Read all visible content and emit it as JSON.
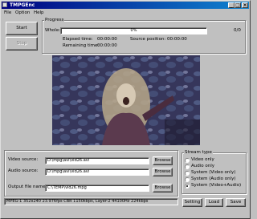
{
  "window": {
    "title": "TMPGEnc"
  },
  "titlebar": {
    "minimize": "_",
    "maximize": "□",
    "close": "×"
  },
  "menu": [
    "File",
    "Option",
    "Help"
  ],
  "buttons": {
    "start": "Start",
    "stop": "Stop",
    "browse": "Browse",
    "setting": "Setting",
    "load": "Load",
    "save": "Save"
  },
  "progress": {
    "group_label": "Progress",
    "whole_label": "Whole:",
    "percent_text": "0%",
    "fraction": 0,
    "frame_count": "0/0",
    "elapsed_label": "Elapsed time:",
    "elapsed_value": "00:00:00",
    "remaining_label": "Remaining time:",
    "remaining_value": "00:00:00",
    "source_pos_label": "Source position:",
    "source_pos_value": "00:00:00"
  },
  "fields": {
    "video_source_label": "Video source:",
    "video_source_value": "D:\\mpg\\avi\\vid26.avi",
    "audio_source_label": "Audio source:",
    "audio_source_value": "D:\\mpg\\avi\\vid26.avi",
    "output_label": "Output file name:",
    "output_value": "C:\\TEMP\\vid26.mpg"
  },
  "stream_type": {
    "label": "Stream type",
    "options": [
      "Video only",
      "Audio only",
      "System (Video only)",
      "System (Audio only)",
      "System (Video+Audio)"
    ],
    "selected": "System (Video+Audio)"
  },
  "status": {
    "text": "MPEG-1 352x240 23.976fps CBR 1150kbps, Layer-2 44100Hz 224kbps"
  },
  "colors": {
    "titlebar_start": "#000080",
    "titlebar_end": "#1084d0",
    "face": "#c0c0c0"
  }
}
